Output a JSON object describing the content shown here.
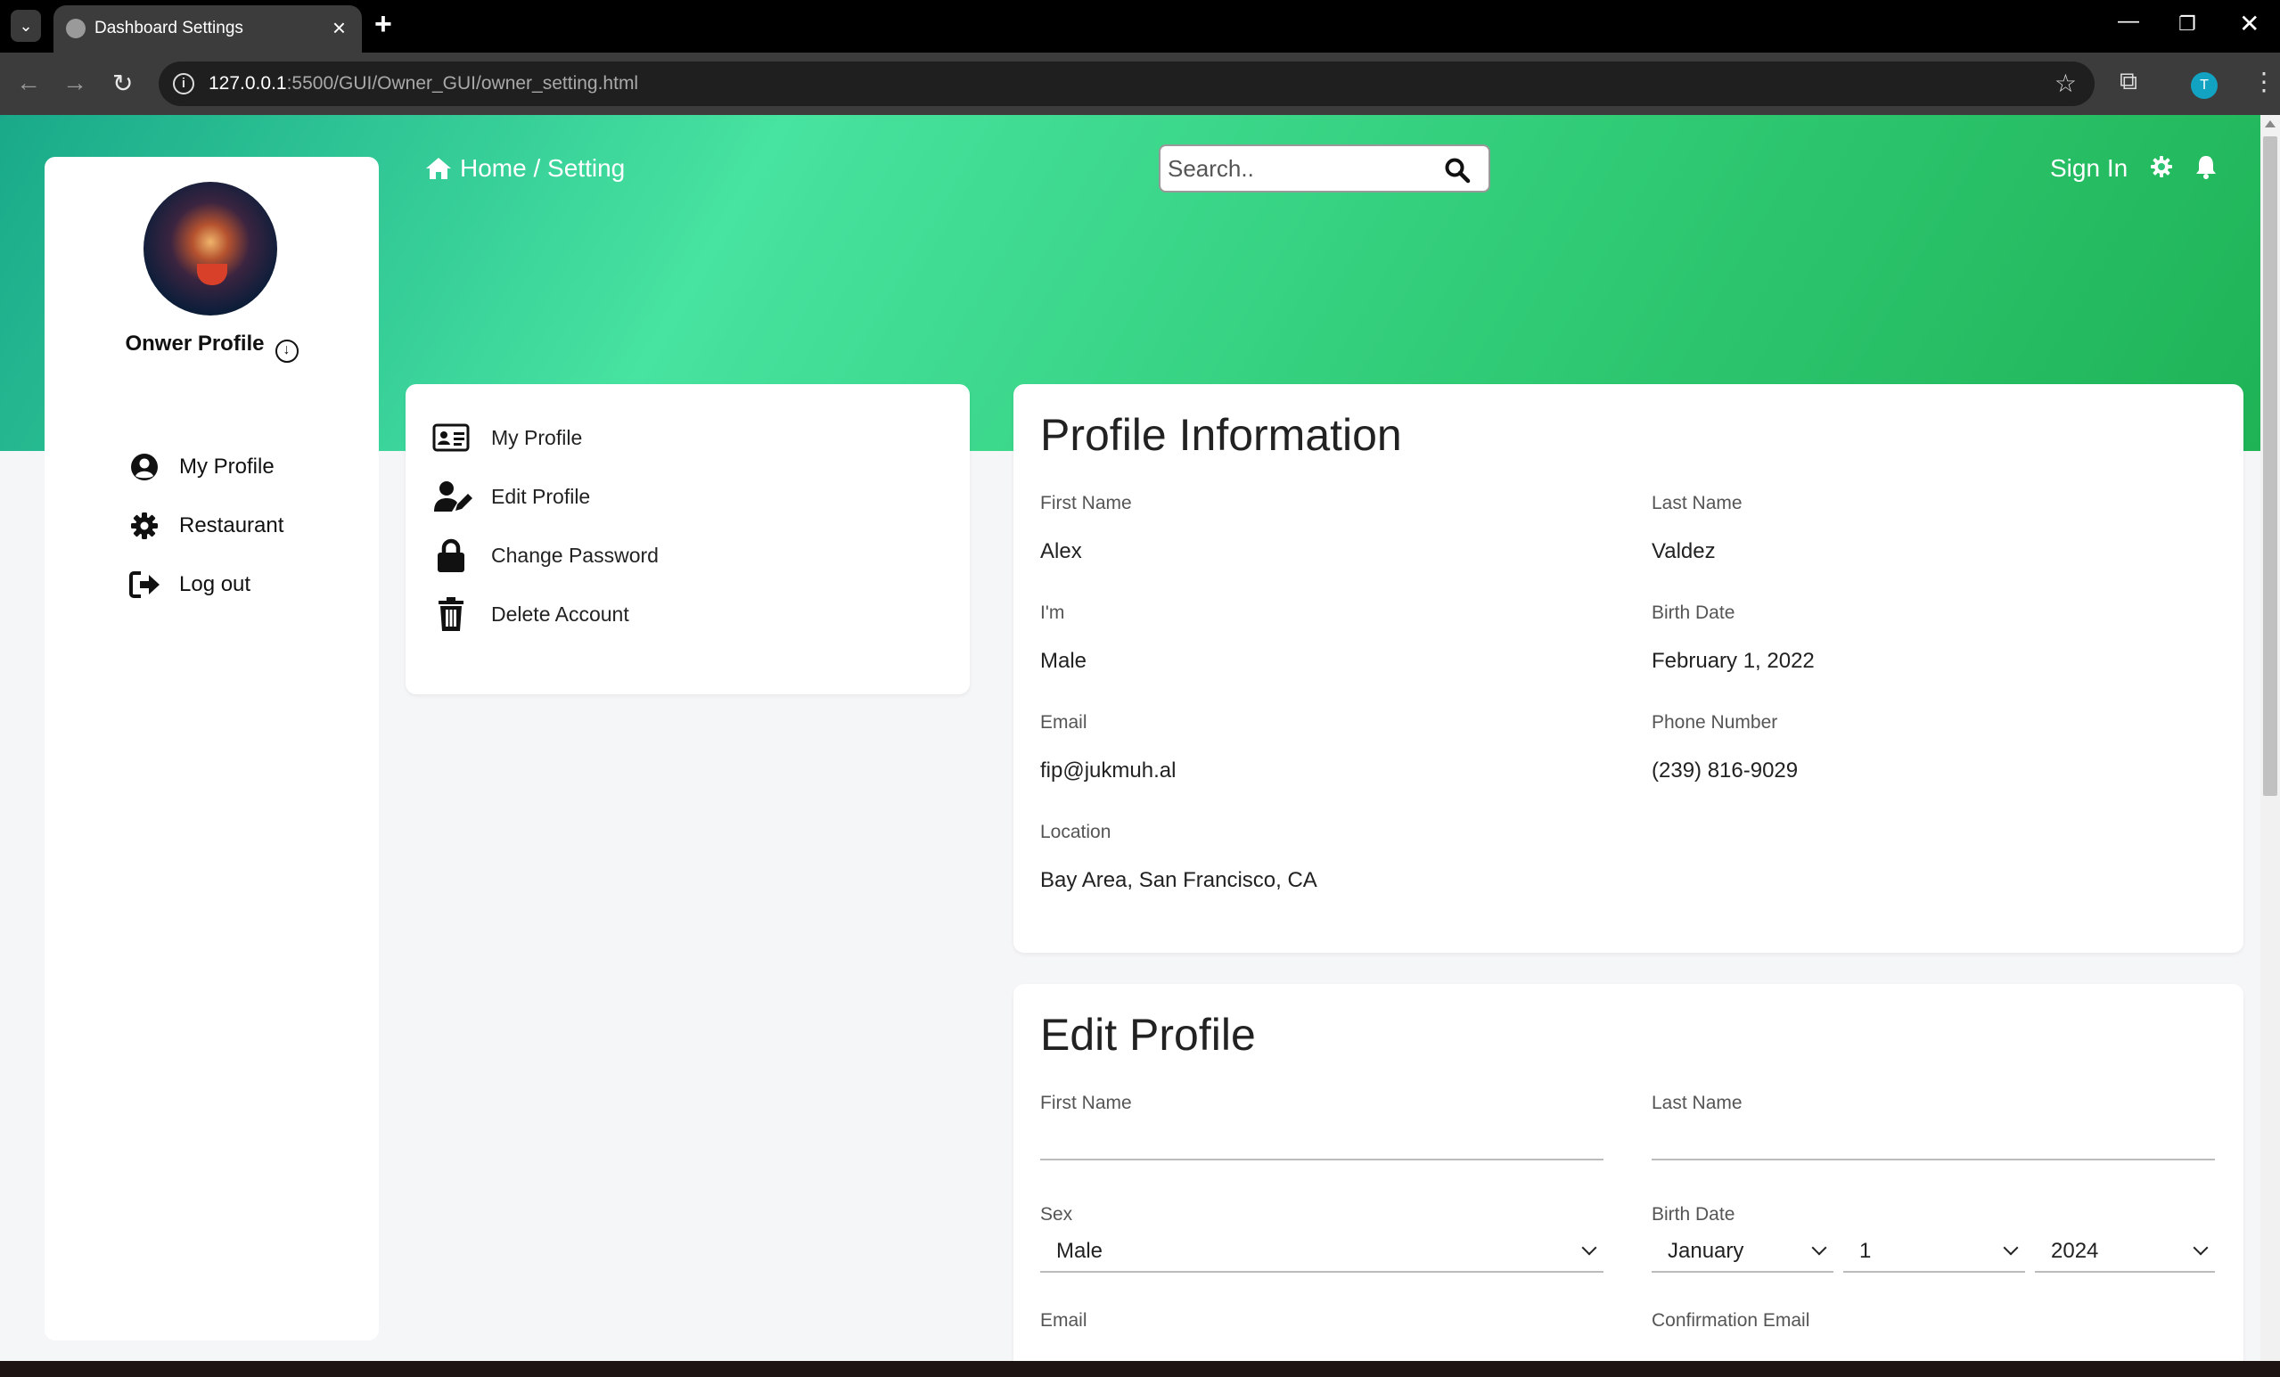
{
  "browser": {
    "tab_title": "Dashboard Settings",
    "url_host": "127.0.0.1",
    "url_rest": ":5500/GUI/Owner_GUI/owner_setting.html",
    "profile_initial": "T"
  },
  "sidebar": {
    "title": "Onwer Profile",
    "items": [
      {
        "label": "My Profile",
        "icon": "user-circle-icon"
      },
      {
        "label": "Restaurant",
        "icon": "gear-icon"
      },
      {
        "label": "Log out",
        "icon": "logout-icon"
      }
    ]
  },
  "header": {
    "breadcrumb_home": "Home",
    "breadcrumb_sep": " / ",
    "breadcrumb_current": "Setting",
    "search_placeholder": "Search..",
    "signin": "Sign In"
  },
  "settings_menu": {
    "items": [
      {
        "label": "My Profile",
        "icon": "id-card-icon"
      },
      {
        "label": "Edit Profile",
        "icon": "user-edit-icon"
      },
      {
        "label": "Change Password",
        "icon": "lock-icon"
      },
      {
        "label": "Delete Account",
        "icon": "trash-icon"
      }
    ]
  },
  "profile_info": {
    "title": "Profile Information",
    "first_name_label": "First Name",
    "first_name": "Alex",
    "last_name_label": "Last Name",
    "last_name": "Valdez",
    "sex_label": "I'm",
    "sex": "Male",
    "birth_label": "Birth Date",
    "birth": "February 1, 2022",
    "email_label": "Email",
    "email": "fip@jukmuh.al",
    "phone_label": "Phone Number",
    "phone": "(239) 816-9029",
    "location_label": "Location",
    "location": "Bay Area, San Francisco, CA"
  },
  "edit_profile": {
    "title": "Edit Profile",
    "first_name_label": "First Name",
    "last_name_label": "Last Name",
    "sex_label": "Sex",
    "sex_value": "Male",
    "birth_label": "Birth Date",
    "birth_month": "January",
    "birth_day": "1",
    "birth_year": "2024",
    "email_label": "Email",
    "confirm_email_label": "Confirmation Email"
  },
  "colors": {
    "hero_start": "#19a98a",
    "hero_mid": "#47e3a0",
    "hero_end": "#1fb356"
  }
}
